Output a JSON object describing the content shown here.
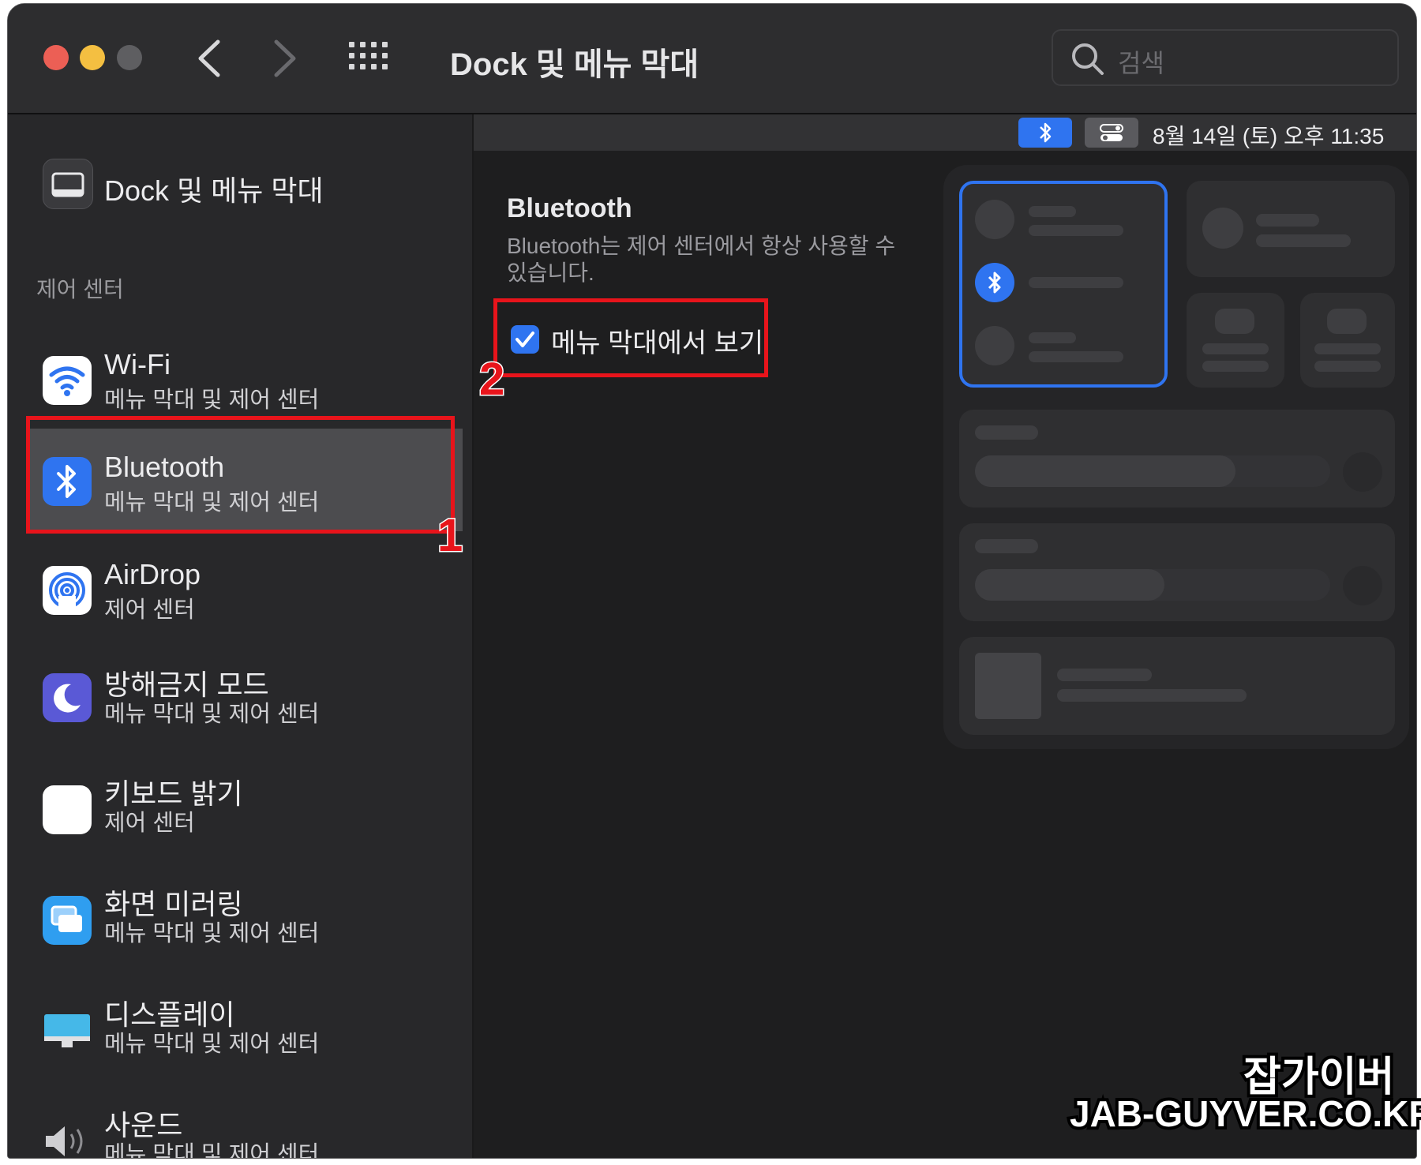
{
  "window": {
    "title": "Dock 및 메뉴 막대",
    "search_placeholder": "검색",
    "traffic_lights": {
      "close": "#ec5f55",
      "minimize": "#f4bf41",
      "zoom": "#5e5e61"
    }
  },
  "sidebar": {
    "top_item": {
      "label": "Dock 및 메뉴 막대",
      "icon": "dock-icon"
    },
    "section_header": "제어 센터",
    "items": [
      {
        "title": "Wi-Fi",
        "subtitle": "메뉴 막대 및 제어 센터",
        "icon": "wifi-icon",
        "icon_color": "#ffffff"
      },
      {
        "title": "Bluetooth",
        "subtitle": "메뉴 막대 및 제어 센터",
        "icon": "bluetooth-icon",
        "icon_color": "#2f74f0",
        "selected": true
      },
      {
        "title": "AirDrop",
        "subtitle": "제어 센터",
        "icon": "airdrop-icon",
        "icon_color": "#ffffff"
      },
      {
        "title": "방해금지 모드",
        "subtitle": "메뉴 막대 및 제어 센터",
        "icon": "moon-icon",
        "icon_color": "#5a59d6"
      },
      {
        "title": "키보드 밝기",
        "subtitle": "제어 센터",
        "icon": "keyboard-brightness-icon",
        "icon_color": "#ffffff"
      },
      {
        "title": "화면 미러링",
        "subtitle": "메뉴 막대 및 제어 센터",
        "icon": "screen-mirroring-icon",
        "icon_color": "#2f9ef0"
      },
      {
        "title": "디스플레이",
        "subtitle": "메뉴 막대 및 제어 센터",
        "icon": "display-icon",
        "icon_color": "#45b8e8"
      },
      {
        "title": "사운드",
        "subtitle": "메뉴 막대 및 제어 센터",
        "icon": "speaker-icon",
        "icon_color": "#cfcfd2"
      }
    ]
  },
  "menubar_preview": {
    "clock": "8월 14일 (토) 오후  11:35"
  },
  "detail": {
    "heading": "Bluetooth",
    "description": "Bluetooth는 제어 센터에서 항상 사용할 수 있습니다.",
    "checkbox_label": "메뉴 막대에서 보기",
    "checkbox_checked": true
  },
  "annotations": {
    "step1": "1",
    "step2": "2",
    "color": "#e8141b"
  },
  "watermark": {
    "line1": "잡가이버",
    "line2": "JAB-GUYVER.CO.KR"
  }
}
